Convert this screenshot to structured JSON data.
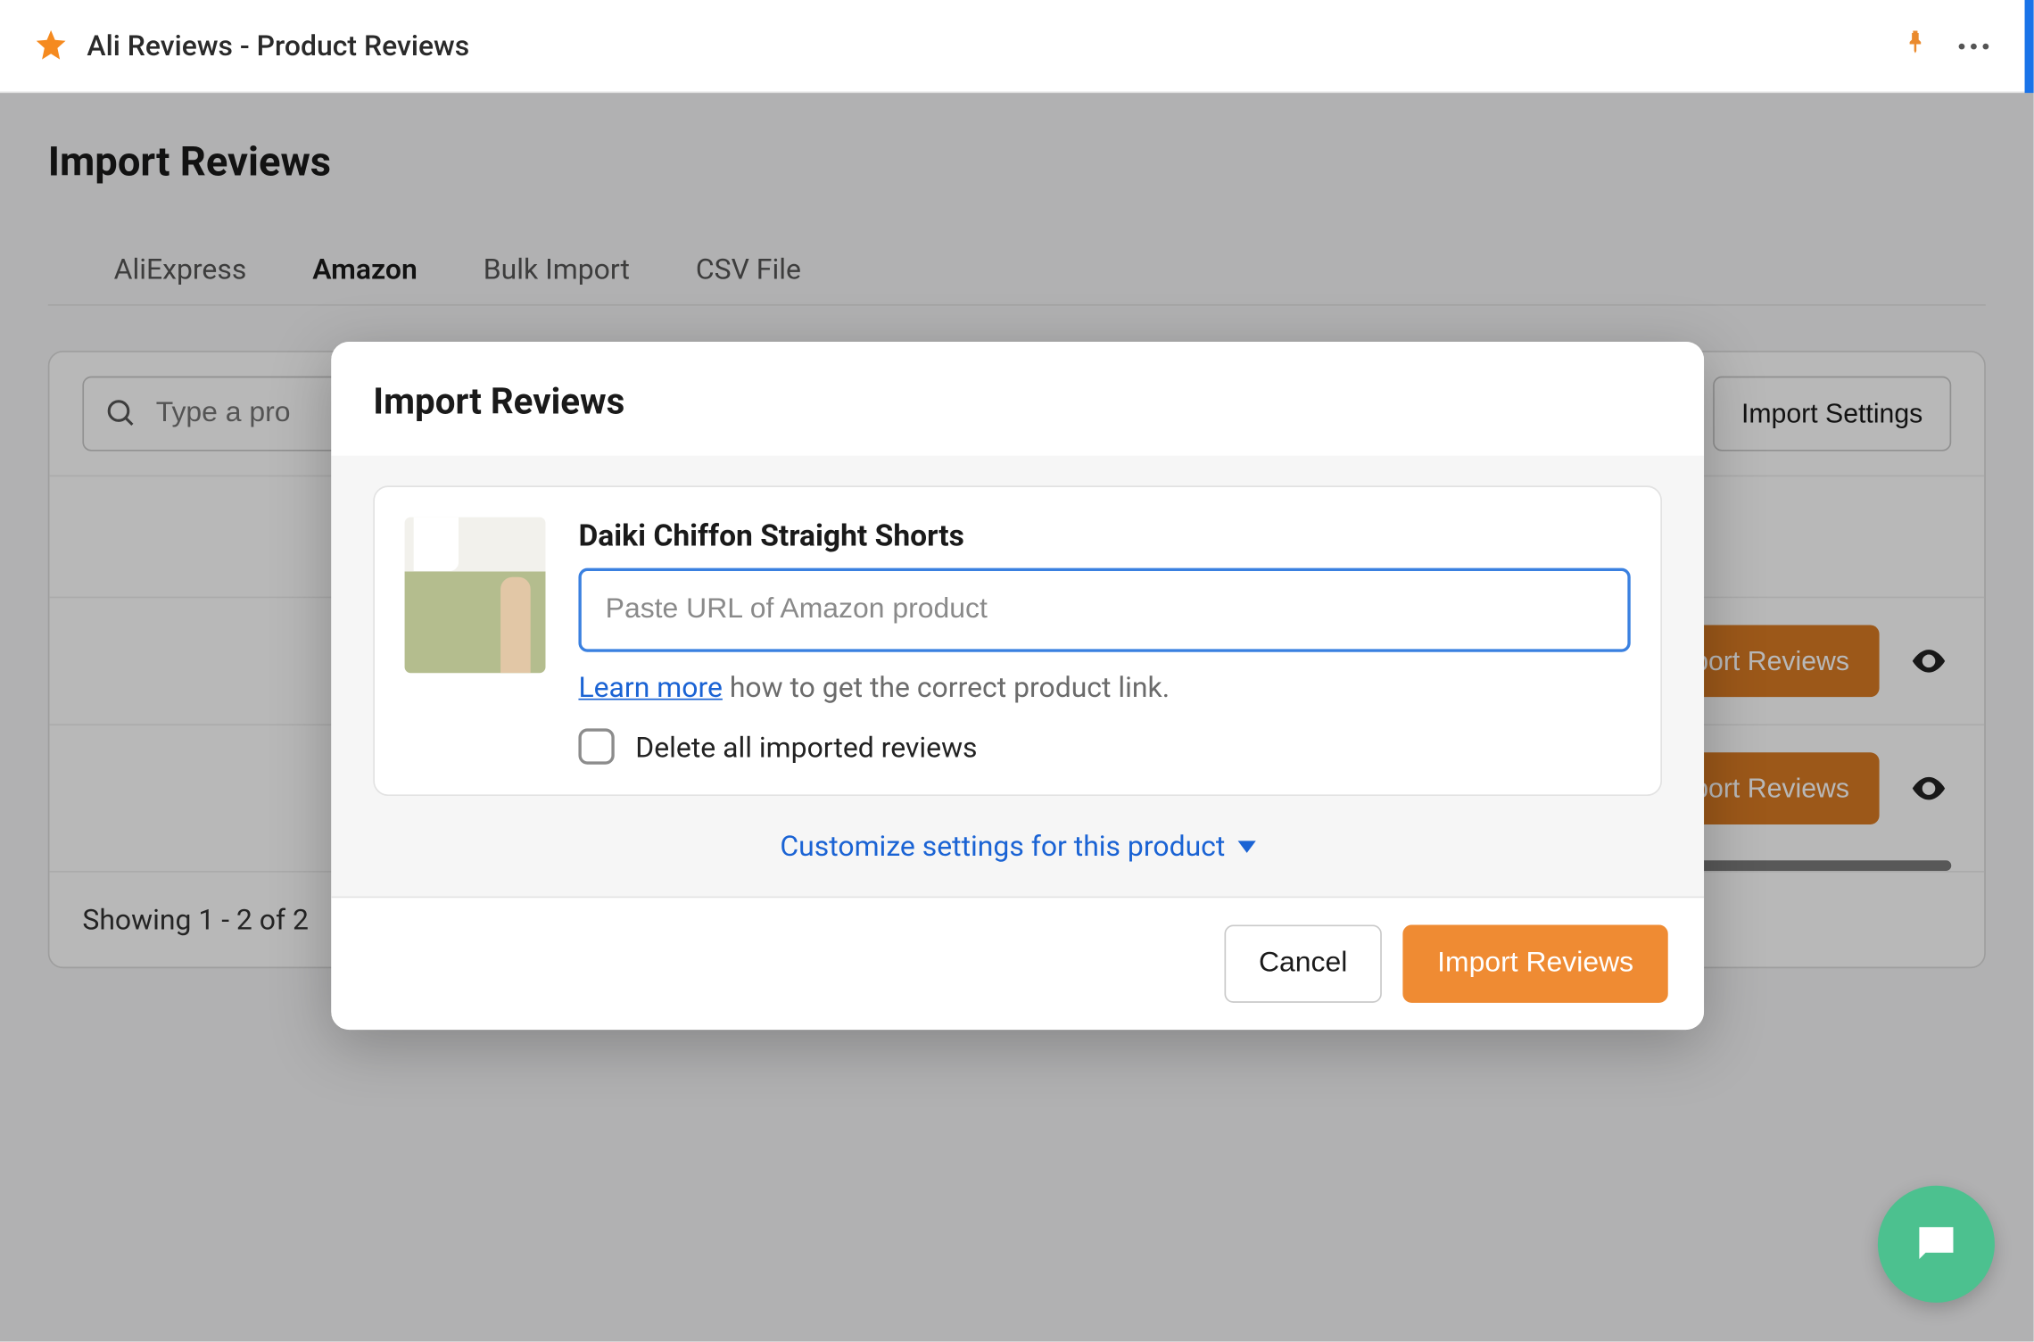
{
  "app": {
    "title": "Ali Reviews - Product Reviews"
  },
  "page": {
    "title": "Import Reviews"
  },
  "tabs": {
    "items": [
      {
        "label": "AliExpress"
      },
      {
        "label": "Amazon"
      },
      {
        "label": "Bulk Import"
      },
      {
        "label": "CSV File"
      }
    ],
    "active_index": 1
  },
  "search": {
    "placeholder": "Type a pro"
  },
  "toolbar": {
    "import_settings_label": "Import Settings"
  },
  "rows": [
    {
      "button_label": "Import Reviews"
    },
    {
      "button_label": "Import Reviews"
    }
  ],
  "pagination": {
    "text": "Showing 1 - 2 of 2"
  },
  "modal": {
    "title": "Import Reviews",
    "product_name": "Daiki Chiffon Straight Shorts",
    "url_placeholder": "Paste URL of Amazon product",
    "learn_more_label": "Learn more",
    "help_tail": " how to get the correct product link.",
    "delete_checkbox_label": "Delete all imported reviews",
    "customize_label": "Customize settings for this product",
    "cancel_label": "Cancel",
    "submit_label": "Import Reviews"
  }
}
